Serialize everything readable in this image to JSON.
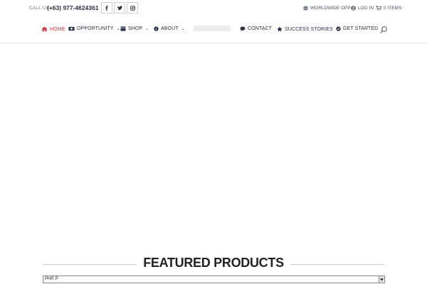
{
  "topbar": {
    "call_label": "CALL US:",
    "phone": "(+63) 977-4624361",
    "social": [
      "facebook-icon",
      "twitter-icon",
      "instagram-icon"
    ],
    "worldwide": "WORLDWIDE OPP",
    "login": "LOG IN",
    "cart": "0 ITEMS"
  },
  "nav": {
    "items": [
      {
        "label": "HOME",
        "icon": "home-icon",
        "active": true
      },
      {
        "label": "OPPORTUNITY",
        "icon": "money-icon",
        "dropdown": true
      },
      {
        "label": "SHOP",
        "icon": "shop-icon",
        "dropdown": true
      },
      {
        "label": "ABOUT",
        "icon": "info-icon",
        "dropdown": true
      },
      {
        "label": "CONTACT",
        "icon": "chat-icon"
      },
      {
        "label": "SUCCESS STORIES",
        "icon": "star-icon",
        "dropdown": true
      },
      {
        "label": "GET STARTED",
        "icon": "check-circle-icon"
      }
    ],
    "search_icon": "search-icon"
  },
  "featured": {
    "title": "FEATURED PRODUCTS"
  },
  "currency": {
    "selected": "PHP, P"
  },
  "colors": {
    "accent": "#d9323a",
    "nav_text": "#2b2f4a"
  }
}
